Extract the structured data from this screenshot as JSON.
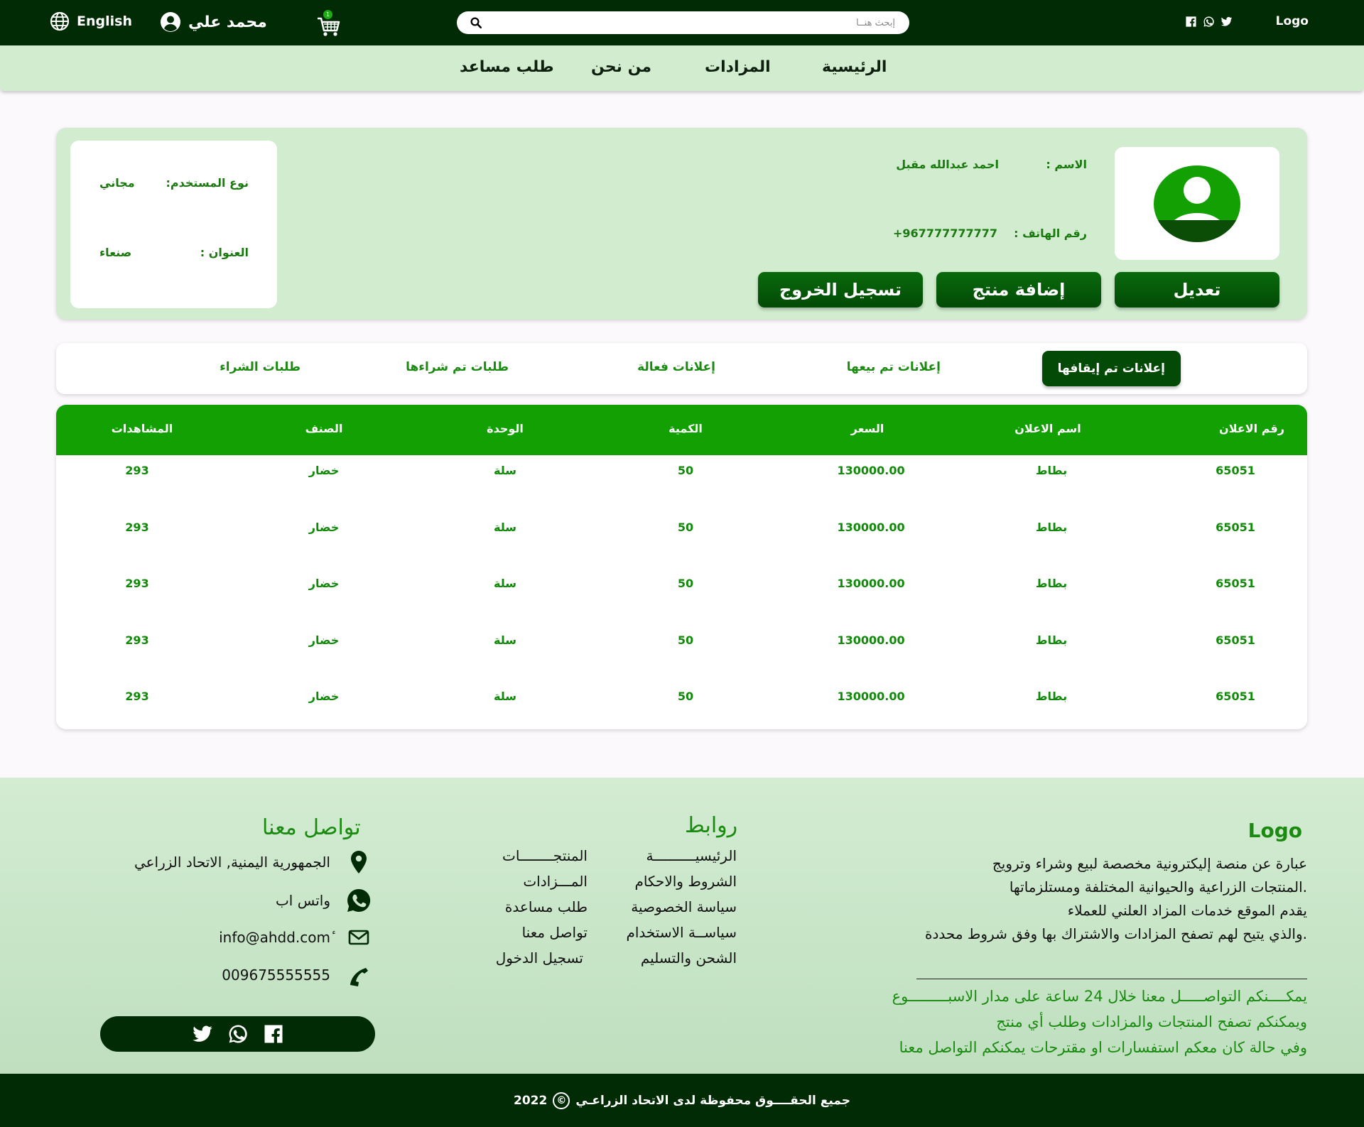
{
  "header": {
    "logo": "Logo",
    "search_placeholder": "إبحث هنــا",
    "cart_count": "1",
    "user_name": "محمد علي",
    "language": "English",
    "social_icons": [
      "twitter-icon",
      "whatsapp-icon",
      "facebook-icon"
    ]
  },
  "nav": {
    "items": [
      "الرئيسية",
      "المزادات",
      "من نحن",
      "طلب مساعد"
    ]
  },
  "profile": {
    "name_label": "الاسم :",
    "name_value": "احمد عبدالله مقبل",
    "phone_label": "رقم الهاتف :",
    "phone_value": "+967777777777",
    "user_type_label": "نوع المستخدم:",
    "user_type_value": "مجاني",
    "address_label": "العنوان :",
    "address_value": "صنعاء",
    "buttons": {
      "edit": "تعديل",
      "add_product": "إضافة منتج",
      "logout": "تسجيل الخروج"
    }
  },
  "tabs": [
    "إعلانات تم إيقافها",
    "إعلانات تم بيعها",
    "إعلانات فعالة",
    "طلبات تم شراءها",
    "طلبات الشراء"
  ],
  "table": {
    "headers": [
      "رقم الاعلان",
      "اسم الاعلان",
      "السعر",
      "الكمية",
      "الوحدة",
      "الصنف",
      "المشاهدات"
    ],
    "rows": [
      [
        "65051",
        "بطاط",
        "130000.00",
        "50",
        "سلة",
        "خضار",
        "293"
      ],
      [
        "65051",
        "بطاط",
        "130000.00",
        "50",
        "سلة",
        "خضار",
        "293"
      ],
      [
        "65051",
        "بطاط",
        "130000.00",
        "50",
        "سلة",
        "خضار",
        "293"
      ],
      [
        "65051",
        "بطاط",
        "130000.00",
        "50",
        "سلة",
        "خضار",
        "293"
      ],
      [
        "65051",
        "بطاط",
        "130000.00",
        "50",
        "سلة",
        "خضار",
        "293"
      ]
    ]
  },
  "footer": {
    "logo": "Logo",
    "about": [
      "عبارة عن منصة إليكترونية مخصصة لبيع وشراء وترويج",
      ".المنتجات الزراعية والحيوانية المختلفة ومستلزماتها",
      "يقدم الموقع خدمات المزاد العلني للعملاء",
      ".والذي يتيح لهم تصفح المزادات والاشتراك بها وفق شروط محددة"
    ],
    "contact_text": [
      "يمكــــنكم التواصـــــل معنا خلال 24 ساعة على مدار الاسبـــــــــوع",
      "ويمكنكم تصفح المنتجات والمزادات وطلب أي منتج",
      "وفي حالة كان معكم استفسارات او مقترحات يمكنكم التواصل معنا"
    ],
    "links_title": "روابط",
    "links_right": [
      "الرئيسيــــــــــة",
      "الشروط والاحكام",
      "سياسة الخصوصية",
      "سياســة الاستخدام",
      "الشحن والتسليم"
    ],
    "links_left": [
      "المنتجــــــــات",
      "المـــزادات",
      "طلب مساعدة",
      "تواصل معنا",
      "تسجيل الدخول"
    ],
    "contact_title": "تواصل معنا",
    "contact": {
      "address": "الجمهورية اليمنية, الاتحاد الزراعي",
      "whatsapp": "واتس اب",
      "email": "info@ahdd.comٔ",
      "phone": "009675555555"
    },
    "copyright_text": "جميع الحقــــوق محفوظة لدى الاتحاد الزراعـي",
    "copyright_symbol": "©",
    "copyright_year": "2022"
  },
  "colors": {
    "dark_green": "#002b04",
    "light_green": "#d1eccf",
    "accent_green": "#13a003",
    "button_green": "#024a06",
    "text_green": "#1a8a10"
  }
}
